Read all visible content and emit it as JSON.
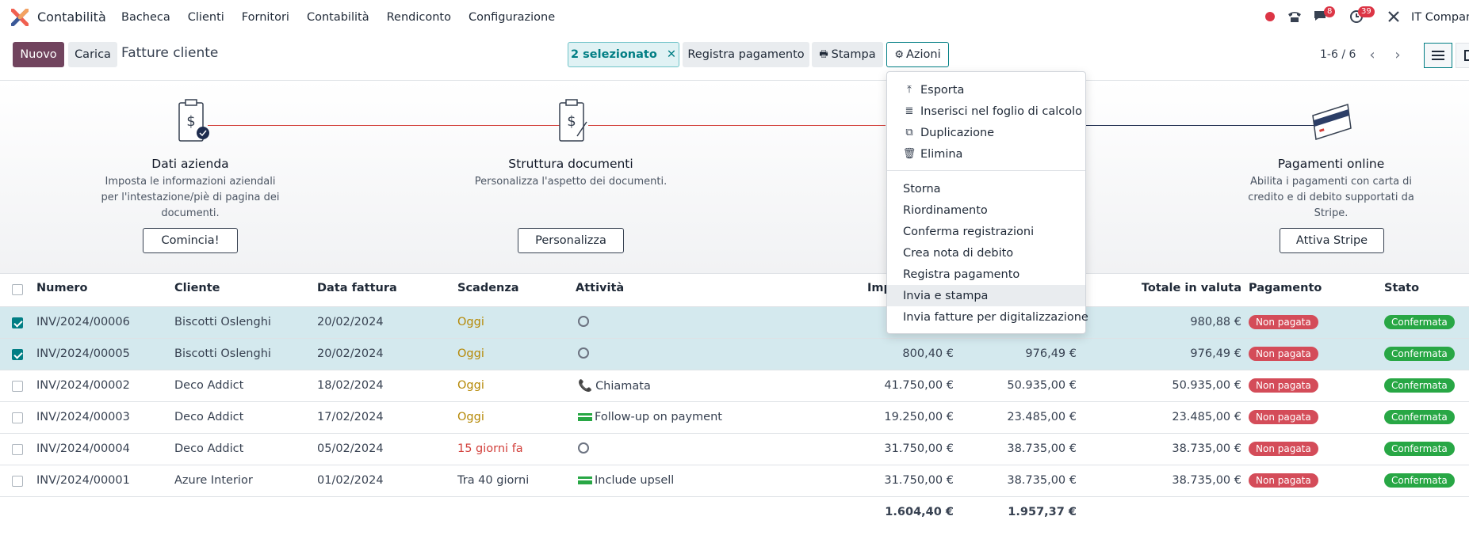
{
  "navbar": {
    "app_name": "Contabilità",
    "menu": [
      "Bacheca",
      "Clienti",
      "Fornitori",
      "Contabilità",
      "Rendiconto",
      "Configurazione"
    ],
    "messages_count": "8",
    "activities_count": "39",
    "company": "IT Company"
  },
  "control_panel": {
    "new_label": "Nuovo",
    "upload_label": "Carica",
    "title": "Fatture cliente",
    "selected_label": "2 selezionato",
    "register_payment_label": "Registra pagamento",
    "print_label": "Stampa",
    "actions_label": "Azioni",
    "pager": "1-6 / 6"
  },
  "actions_menu": {
    "group1": [
      {
        "label": "Esporta",
        "icon": "upload-icon"
      },
      {
        "label": "Inserisci nel foglio di calcolo",
        "icon": "list-icon"
      },
      {
        "label": "Duplicazione",
        "icon": "copy-icon"
      },
      {
        "label": "Elimina",
        "icon": "trash-icon"
      }
    ],
    "group2": [
      "Storna",
      "Riordinamento",
      "Conferma registrazioni",
      "Crea nota di debito",
      "Registra pagamento",
      "Invia e stampa",
      "Invia fatture per digitalizzazione"
    ]
  },
  "onboarding": {
    "steps": [
      {
        "title": "Dati azienda",
        "desc": "Imposta le informazioni aziendali per l'intestazione/piè di pagina dei documenti.",
        "button": "Comincia!"
      },
      {
        "title": "Struttura documenti",
        "desc": "Personalizza l'aspetto dei documenti.",
        "button": "Personalizza"
      },
      {
        "title": "Pagamenti online",
        "desc": "Abilita i pagamenti con carta di credito e di debito supportati da Stripe.",
        "button": "Attiva Stripe"
      }
    ]
  },
  "table": {
    "headers": {
      "numero": "Numero",
      "cliente": "Cliente",
      "data": "Data fattura",
      "scadenza": "Scadenza",
      "attivita": "Attività",
      "imponibile": "Imp",
      "totale_valuta": "Totale in valuta",
      "pagamento": "Pagamento",
      "stato": "Stato"
    },
    "rows": [
      {
        "numero": "INV/2024/00006",
        "cliente": "Biscotti Oslenghi",
        "data": "20/02/2024",
        "scadenza": "Oggi",
        "attivita": "",
        "imponibile": "",
        "totale": "",
        "totale_valuta": "980,88 €",
        "pagamento": "Non pagata",
        "stato": "Confermata"
      },
      {
        "numero": "INV/2024/00005",
        "cliente": "Biscotti Oslenghi",
        "data": "20/02/2024",
        "scadenza": "Oggi",
        "attivita": "",
        "imponibile": "800,40 €",
        "totale": "976,49 €",
        "totale_valuta": "976,49 €",
        "pagamento": "Non pagata",
        "stato": "Confermata"
      },
      {
        "numero": "INV/2024/00002",
        "cliente": "Deco Addict",
        "data": "18/02/2024",
        "scadenza": "Oggi",
        "attivita": "Chiamata",
        "imponibile": "41.750,00 €",
        "totale": "50.935,00 €",
        "totale_valuta": "50.935,00 €",
        "pagamento": "Non pagata",
        "stato": "Confermata"
      },
      {
        "numero": "INV/2024/00003",
        "cliente": "Deco Addict",
        "data": "17/02/2024",
        "scadenza": "Oggi",
        "attivita": "Follow-up on payment",
        "imponibile": "19.250,00 €",
        "totale": "23.485,00 €",
        "totale_valuta": "23.485,00 €",
        "pagamento": "Non pagata",
        "stato": "Confermata"
      },
      {
        "numero": "INV/2024/00004",
        "cliente": "Deco Addict",
        "data": "05/02/2024",
        "scadenza": "15 giorni fa",
        "attivita": "",
        "imponibile": "31.750,00 €",
        "totale": "38.735,00 €",
        "totale_valuta": "38.735,00 €",
        "pagamento": "Non pagata",
        "stato": "Confermata"
      },
      {
        "numero": "INV/2024/00001",
        "cliente": "Azure Interior",
        "data": "01/02/2024",
        "scadenza": "Tra 40 giorni",
        "attivita": "Include upsell",
        "imponibile": "31.750,00 €",
        "totale": "38.735,00 €",
        "totale_valuta": "38.735,00 €",
        "pagamento": "Non pagata",
        "stato": "Confermata"
      }
    ],
    "footer": {
      "imponibile": "1.604,40 €",
      "totale": "1.957,37 €"
    }
  },
  "colors": {
    "primary": "#71445e",
    "accent": "#017e84",
    "danger": "#d44c59",
    "success": "#28a745"
  }
}
